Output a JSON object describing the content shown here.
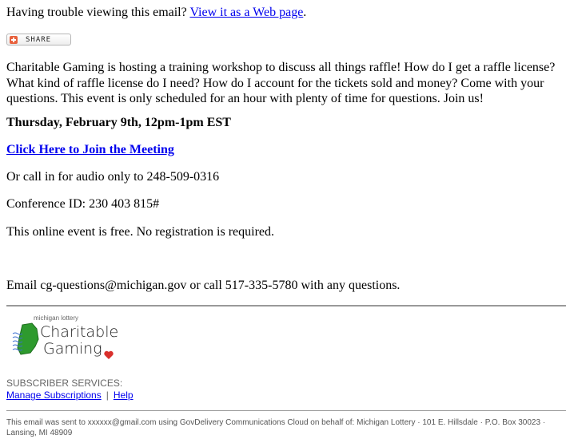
{
  "header": {
    "trouble_text": "Having trouble viewing this email? ",
    "web_link": "View it as a Web page",
    "trouble_suffix": "."
  },
  "share_button": {
    "label": "SHARE",
    "icon": "plus-icon"
  },
  "body": {
    "intro": "Charitable Gaming is hosting a training workshop to discuss all things raffle!  How do I get a raffle license? What kind of raffle license do I need? How do I account for the tickets sold and money?  Come with your questions.  This event is only scheduled for an hour with plenty of time for questions. Join us!",
    "datetime": "Thursday, February 9th, 12pm-1pm EST",
    "join_link": "Click Here to Join the Meeting",
    "call_in": "Or call in for audio only to 248-509-0316",
    "conference_id": "Conference ID: 230 403 815#",
    "free_note": "This online event is free.  No registration is required.",
    "contact": "Email cg-questions@michigan.gov or call 517-335-5780 with any questions."
  },
  "logo": {
    "top_text": "michigan lottery",
    "line1": "Charitable",
    "line2": "Gaming",
    "colors": {
      "michigan": "#2e9a2e",
      "water": "#3b6fd1",
      "heart": "#d9302c"
    }
  },
  "subscriber": {
    "heading": "SUBSCRIBER SERVICES:",
    "manage_link": "Manage Subscriptions",
    "separator": "|",
    "help_link": "Help"
  },
  "footer": {
    "text": "This email was sent to xxxxxx@gmail.com using GovDelivery Communications Cloud on behalf of: Michigan Lottery · 101 E. Hillsdale · P.O. Box 30023 · Lansing, MI 48909"
  }
}
